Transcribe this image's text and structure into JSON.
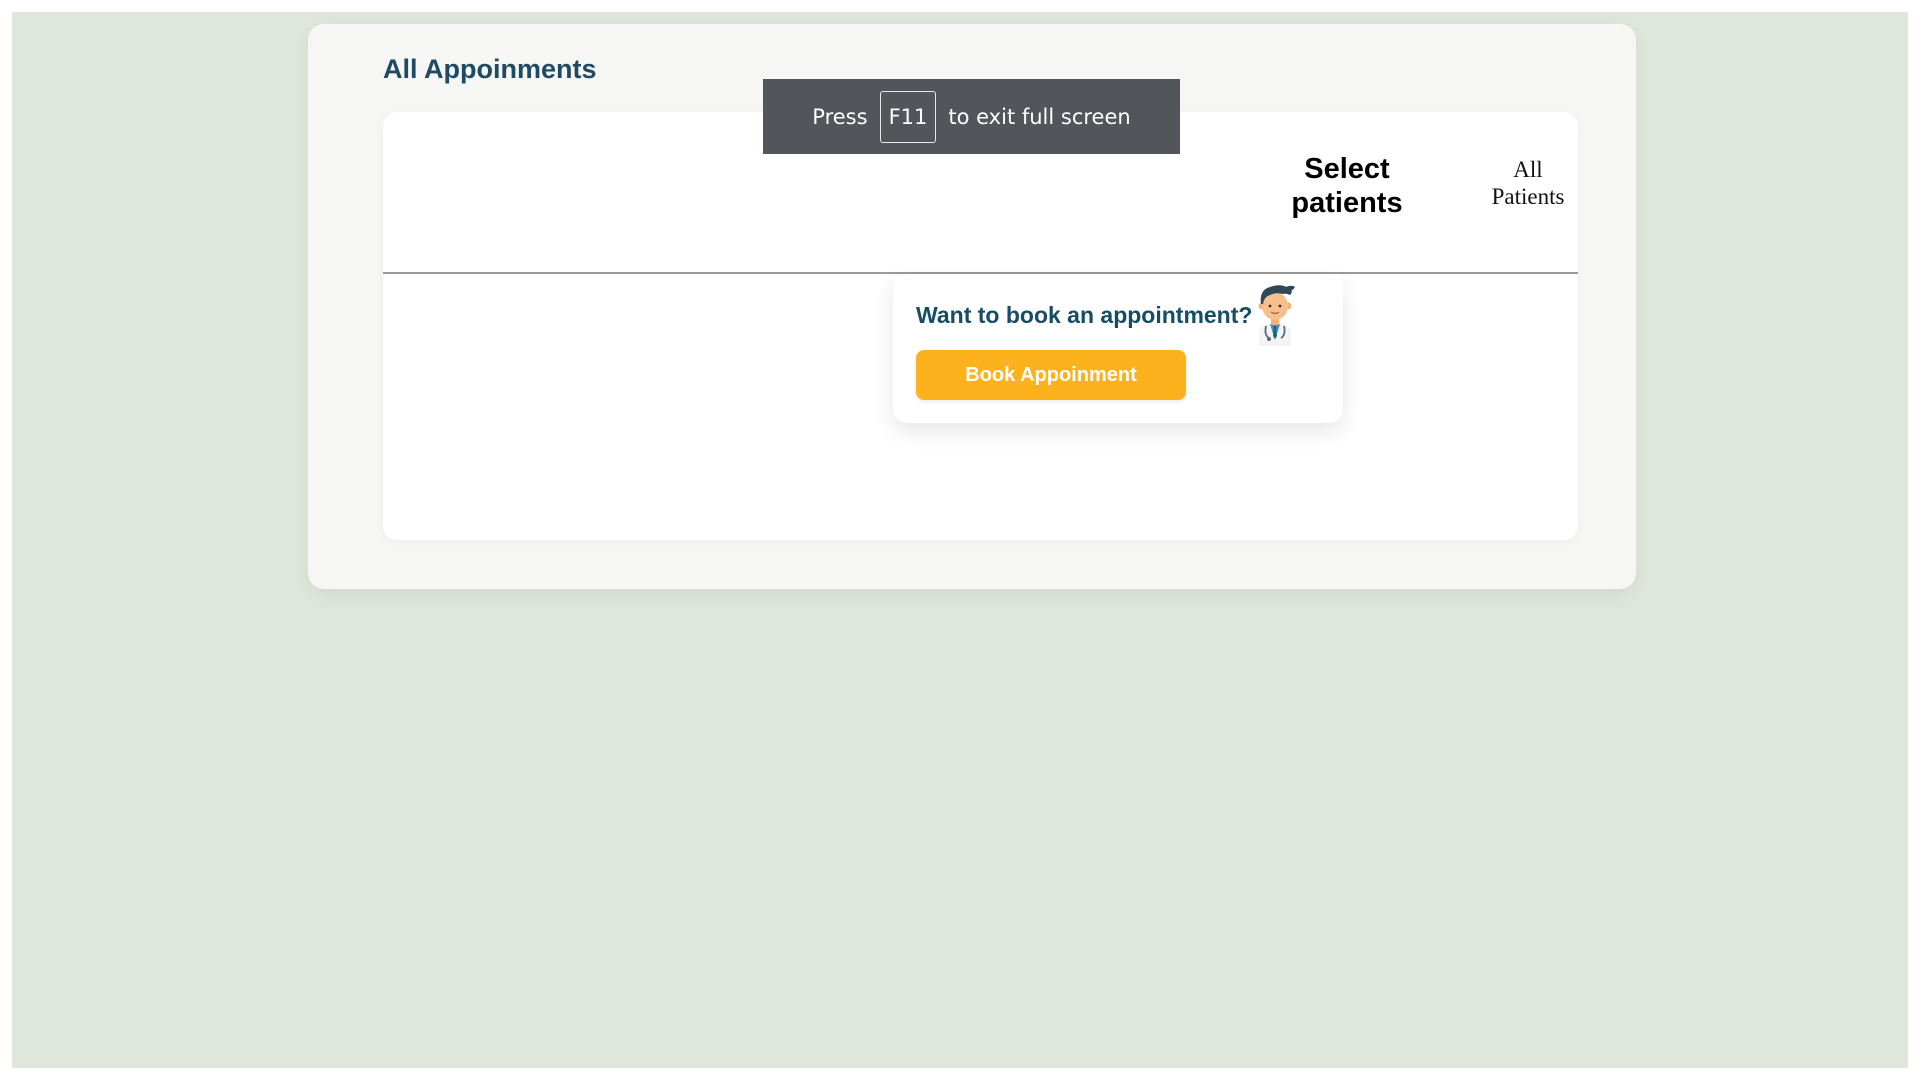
{
  "page": {
    "title": "All Appoinments"
  },
  "patient_filter": {
    "label": "Select patients",
    "value": "All Patients"
  },
  "booking": {
    "question": "Want to book an appointment?",
    "button_label": "Book Appoinment",
    "illustration": "doctor-icon"
  },
  "fullscreen_notice": {
    "before": "Press",
    "key": "F11",
    "after": "to exit full screen"
  },
  "colors": {
    "background": "#dfe6dc",
    "title": "#1f4a63",
    "button": "#fbb21d",
    "notice": "#525559"
  }
}
